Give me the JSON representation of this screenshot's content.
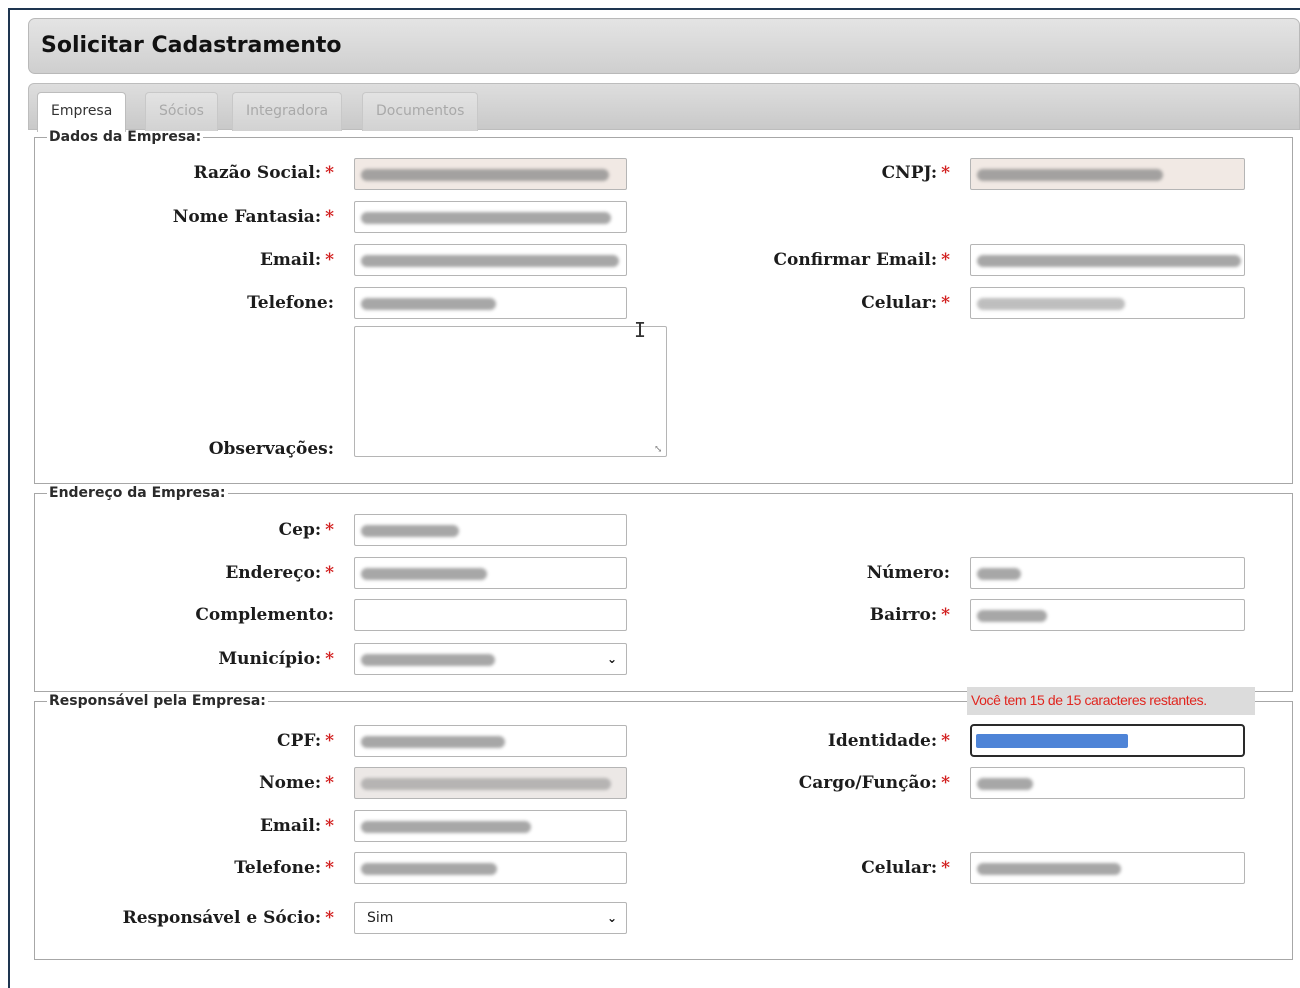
{
  "page": {
    "title": "Solicitar Cadastramento"
  },
  "tabs": [
    {
      "label": "Empresa",
      "active": true
    },
    {
      "label": "Sócios",
      "active": false
    },
    {
      "label": "Integradora",
      "active": false
    },
    {
      "label": "Documentos",
      "active": false
    }
  ],
  "empresa": {
    "legend": "Dados da Empresa:",
    "razao_social_label": "Razão Social:",
    "cnpj_label": "CNPJ:",
    "nome_fantasia_label": "Nome Fantasia:",
    "email_label": "Email:",
    "confirmar_email_label": "Confirmar Email:",
    "telefone_label": "Telefone:",
    "celular_label": "Celular:",
    "observacoes_label": "Observações:"
  },
  "endereco": {
    "legend": "Endereço da Empresa:",
    "cep_label": "Cep:",
    "endereco_label": "Endereço:",
    "numero_label": "Número:",
    "complemento_label": "Complemento:",
    "bairro_label": "Bairro:",
    "municipio_label": "Município:"
  },
  "responsavel": {
    "legend": "Responsável pela Empresa:",
    "cpf_label": "CPF:",
    "identidade_label": "Identidade:",
    "nome_label": "Nome:",
    "cargo_label": "Cargo/Função:",
    "email_label": "Email:",
    "telefone_label": "Telefone:",
    "celular_label": "Celular:",
    "responsavel_socio_label": "Responsável e Sócio:",
    "responsavel_socio_value": "Sim",
    "char_hint": "Você tem 15 de 15 caracteres restantes."
  },
  "required_marker": "*",
  "colors": {
    "required": "#d21f1f",
    "hint": "#e0261f",
    "readonly_bg": "#f1e9e4"
  }
}
